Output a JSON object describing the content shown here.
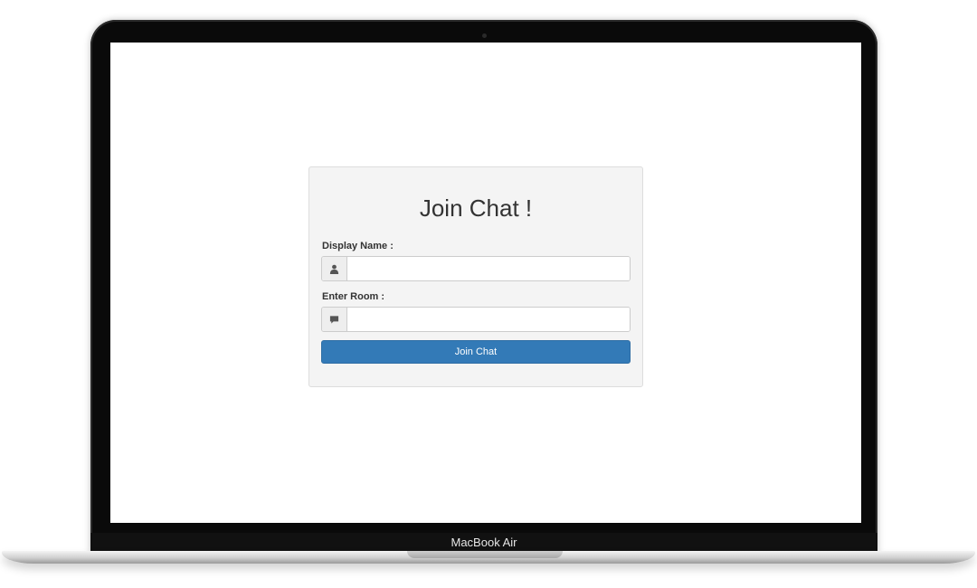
{
  "device": {
    "model_label": "MacBook Air"
  },
  "form": {
    "title": "Join Chat !",
    "display_name_label": "Display Name :",
    "display_name_value": "",
    "display_name_icon": "user-icon",
    "room_label": "Enter Room :",
    "room_value": "",
    "room_icon": "chat-bubble-icon",
    "submit_label": "Join Chat"
  },
  "colors": {
    "primary_button": "#337ab7",
    "panel_background": "#f4f4f4"
  }
}
